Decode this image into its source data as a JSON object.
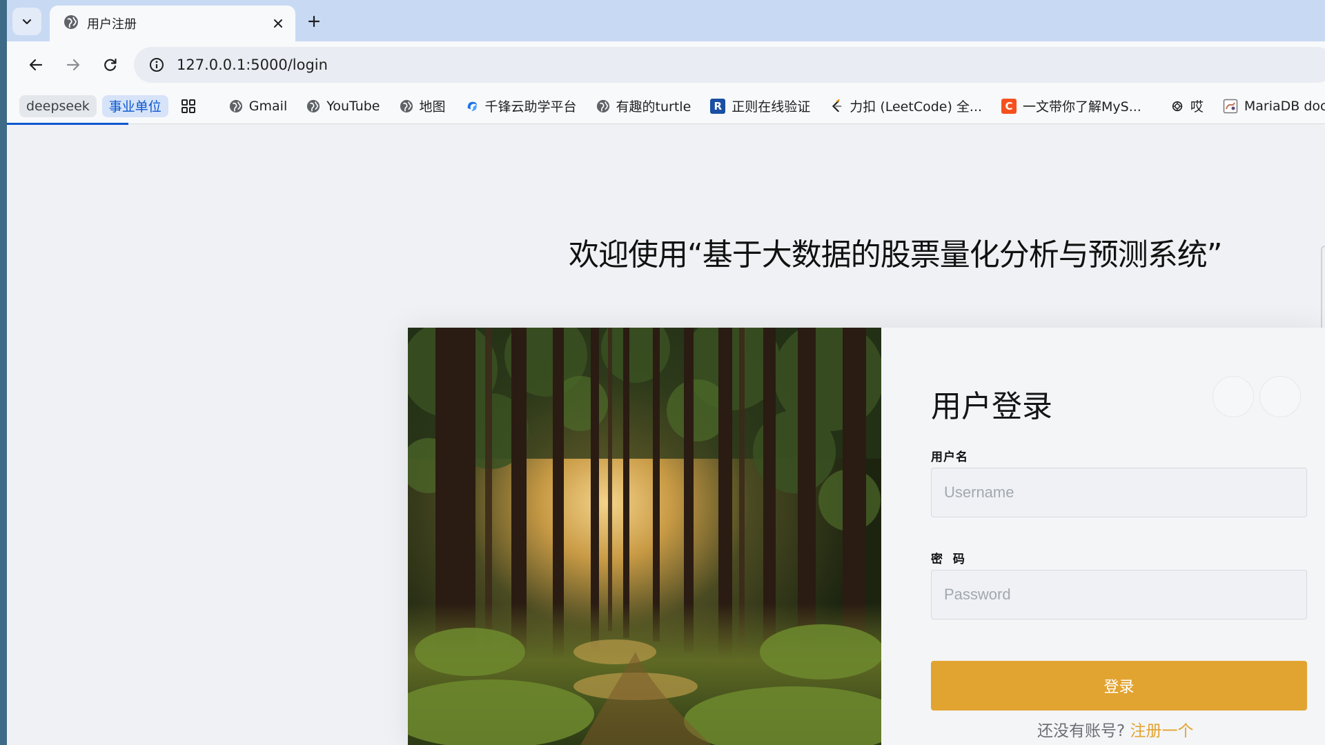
{
  "browser": {
    "tab": {
      "title": "用户注册"
    },
    "address_bar": {
      "url": "127.0.0.1:5000/login"
    },
    "bookmarks": [
      {
        "label": "deepseek",
        "style": "pill"
      },
      {
        "label": "事业单位",
        "style": "pill-blue"
      },
      {
        "label": "",
        "icon": "apps-grid-icon"
      },
      {
        "label": "Gmail",
        "icon": "globe-icon"
      },
      {
        "label": "YouTube",
        "icon": "globe-icon"
      },
      {
        "label": "地图",
        "icon": "globe-icon"
      },
      {
        "label": "千锋云助学平台",
        "icon": "qianfeng-icon"
      },
      {
        "label": "有趣的turtle",
        "icon": "globe-icon"
      },
      {
        "label": "正则在线验证",
        "icon": "r-icon"
      },
      {
        "label": "力扣 (LeetCode) 全...",
        "icon": "leetcode-icon"
      },
      {
        "label": "一文带你了解MyS...",
        "icon": "csdn-icon"
      },
      {
        "label": "哎",
        "icon": "openai-icon"
      },
      {
        "label": "MariaDB docume...",
        "icon": "mariadb-icon"
      }
    ]
  },
  "page": {
    "welcome": "欢迎使用“基于大数据的股票量化分析与预测系统”",
    "login_form": {
      "title": "用户登录",
      "username_label": "用户名",
      "username_placeholder": "Username",
      "password_label": "密  码",
      "password_placeholder": "Password",
      "submit_label": "登录",
      "signup_prompt": "还没有账号? ",
      "signup_link": "注册一个"
    }
  },
  "colors": {
    "accent": "#e2a431",
    "tabstrip": "#c8d9f3",
    "page_bg": "#eff1f4"
  }
}
